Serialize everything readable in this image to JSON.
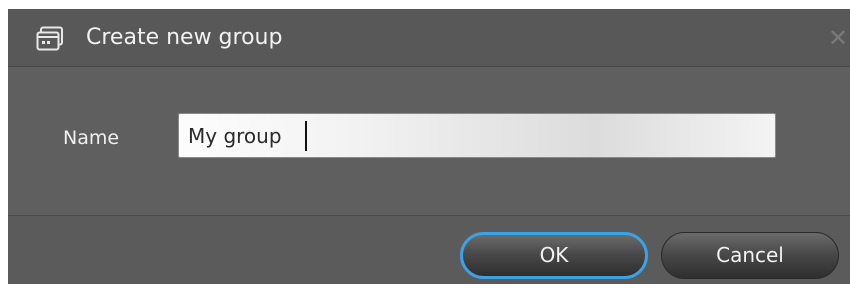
{
  "dialog": {
    "title": "Create new group",
    "title_icon": "group-window-icon",
    "close_glyph": "✕"
  },
  "form": {
    "name_label": "Name",
    "name_value": "My group"
  },
  "buttons": {
    "ok_label": "OK",
    "cancel_label": "Cancel"
  },
  "colors": {
    "focus_accent": "#3aa3e8",
    "dialog_background": "#5f5f5f"
  }
}
